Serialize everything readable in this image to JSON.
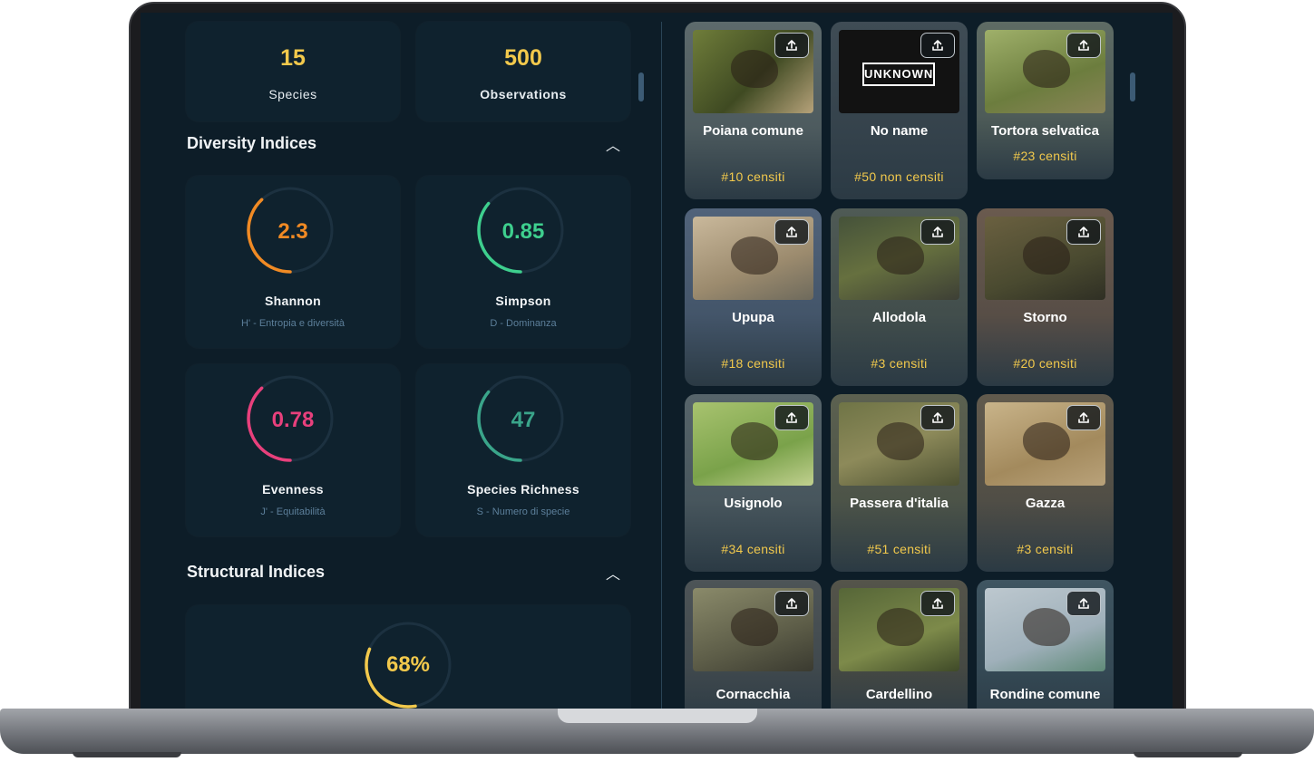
{
  "stats": [
    {
      "value": "15",
      "label": "Species"
    },
    {
      "value": "500",
      "label": "Observations"
    }
  ],
  "diversity": {
    "title": "Diversity Indices",
    "indices": [
      {
        "value": "2.3",
        "name": "Shannon",
        "sub": "H' - Entropia e diversità",
        "color": "#f08a24",
        "fraction": 0.38
      },
      {
        "value": "0.85",
        "name": "Simpson",
        "sub": "D - Dominanza",
        "color": "#3ecf8e",
        "fraction": 0.36
      },
      {
        "value": "0.78",
        "name": "Evenness",
        "sub": "J' - Equitabilità",
        "color": "#e8407c",
        "fraction": 0.38
      },
      {
        "value": "47",
        "name": "Species Richness",
        "sub": "S - Numero di specie",
        "color": "#3aa58a",
        "fraction": 0.36
      }
    ]
  },
  "structural": {
    "title": "Structural Indices",
    "gauge": {
      "value": "68%",
      "color": "#f2c94c",
      "fraction": 0.34
    }
  },
  "unknown_label": "UNKNOWN",
  "birds": [
    {
      "name": "Poiana comune",
      "count": "#10 censiti",
      "icon": "buzzard-photo"
    },
    {
      "name": "No name",
      "count": "#50 non censiti",
      "icon": "unknown-photo"
    },
    {
      "name": "Tortora selvatica",
      "count": "#23 censiti",
      "icon": "turtle-dove-photo"
    },
    {
      "name": "Upupa",
      "count": "#18 censiti",
      "icon": "hoopoe-photo"
    },
    {
      "name": "Allodola",
      "count": "#3 censiti",
      "icon": "skylark-photo"
    },
    {
      "name": "Storno",
      "count": "#20 censiti",
      "icon": "starling-photo"
    },
    {
      "name": "Usignolo",
      "count": "#34 censiti",
      "icon": "nightingale-photo"
    },
    {
      "name": "Passera d'italia",
      "count": "#51 censiti",
      "icon": "sparrow-photo"
    },
    {
      "name": "Gazza",
      "count": "#3 censiti",
      "icon": "magpie-photo"
    },
    {
      "name": "Cornacchia",
      "count": "",
      "icon": "crow-photo"
    },
    {
      "name": "Cardellino",
      "count": "",
      "icon": "goldfinch-photo"
    },
    {
      "name": "Rondine comune",
      "count": "",
      "icon": "swallow-photo"
    }
  ]
}
